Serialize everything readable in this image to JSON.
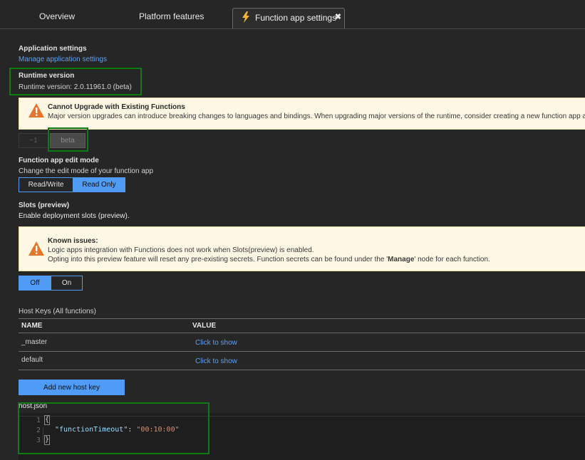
{
  "tabs": {
    "overview": "Overview",
    "platform": "Platform features",
    "settings": "Function app settings"
  },
  "app_settings": {
    "title": "Application settings",
    "link": "Manage application settings"
  },
  "runtime": {
    "title": "Runtime version",
    "value": "Runtime version: 2.0.11961.0 (beta)",
    "warning_title": "Cannot Upgrade with Existing Functions",
    "warning_text": "Major version upgrades can introduce breaking changes to languages and bindings. When upgrading major versions of the runtime, consider creating a new function app and mig",
    "opt1": "~1",
    "opt2": "beta"
  },
  "edit_mode": {
    "title": "Function app edit mode",
    "desc": "Change the edit mode of your function app",
    "opt1": "Read/Write",
    "opt2": "Read Only"
  },
  "slots": {
    "title": "Slots (preview)",
    "desc": "Enable deployment slots (preview).",
    "warning_title": "Known issues:",
    "warning_line1": "Logic apps integration with Functions does not work when Slots(preview) is enabled.",
    "warning_line2_a": "Opting into this preview feature will reset any pre-existing secrets. Function secrets can be found under the '",
    "warning_line2_b": "Manage",
    "warning_line2_c": "' node for each function.",
    "off": "Off",
    "on": "On"
  },
  "host_keys": {
    "title": "Host Keys (All functions)",
    "col_name": "NAME",
    "col_value": "VALUE",
    "rows": [
      {
        "name": "_master",
        "value": "Click to show"
      },
      {
        "name": "default",
        "value": "Click to show"
      }
    ],
    "add_button": "Add new host key"
  },
  "host_json": {
    "title": "host.json",
    "line_numbers": [
      "1",
      "2",
      "3"
    ],
    "open_brace": "{",
    "key": "\"functionTimeout\"",
    "colon": ": ",
    "value": "\"00:10:00\"",
    "close_brace": "}"
  },
  "colors": {
    "background": "#262626",
    "accent": "#4f9bf5",
    "link": "#5ea0ef",
    "highlight": "#0f7a14",
    "warning_bg": "#fdf7e4",
    "warning_icon": "#e8742a"
  }
}
